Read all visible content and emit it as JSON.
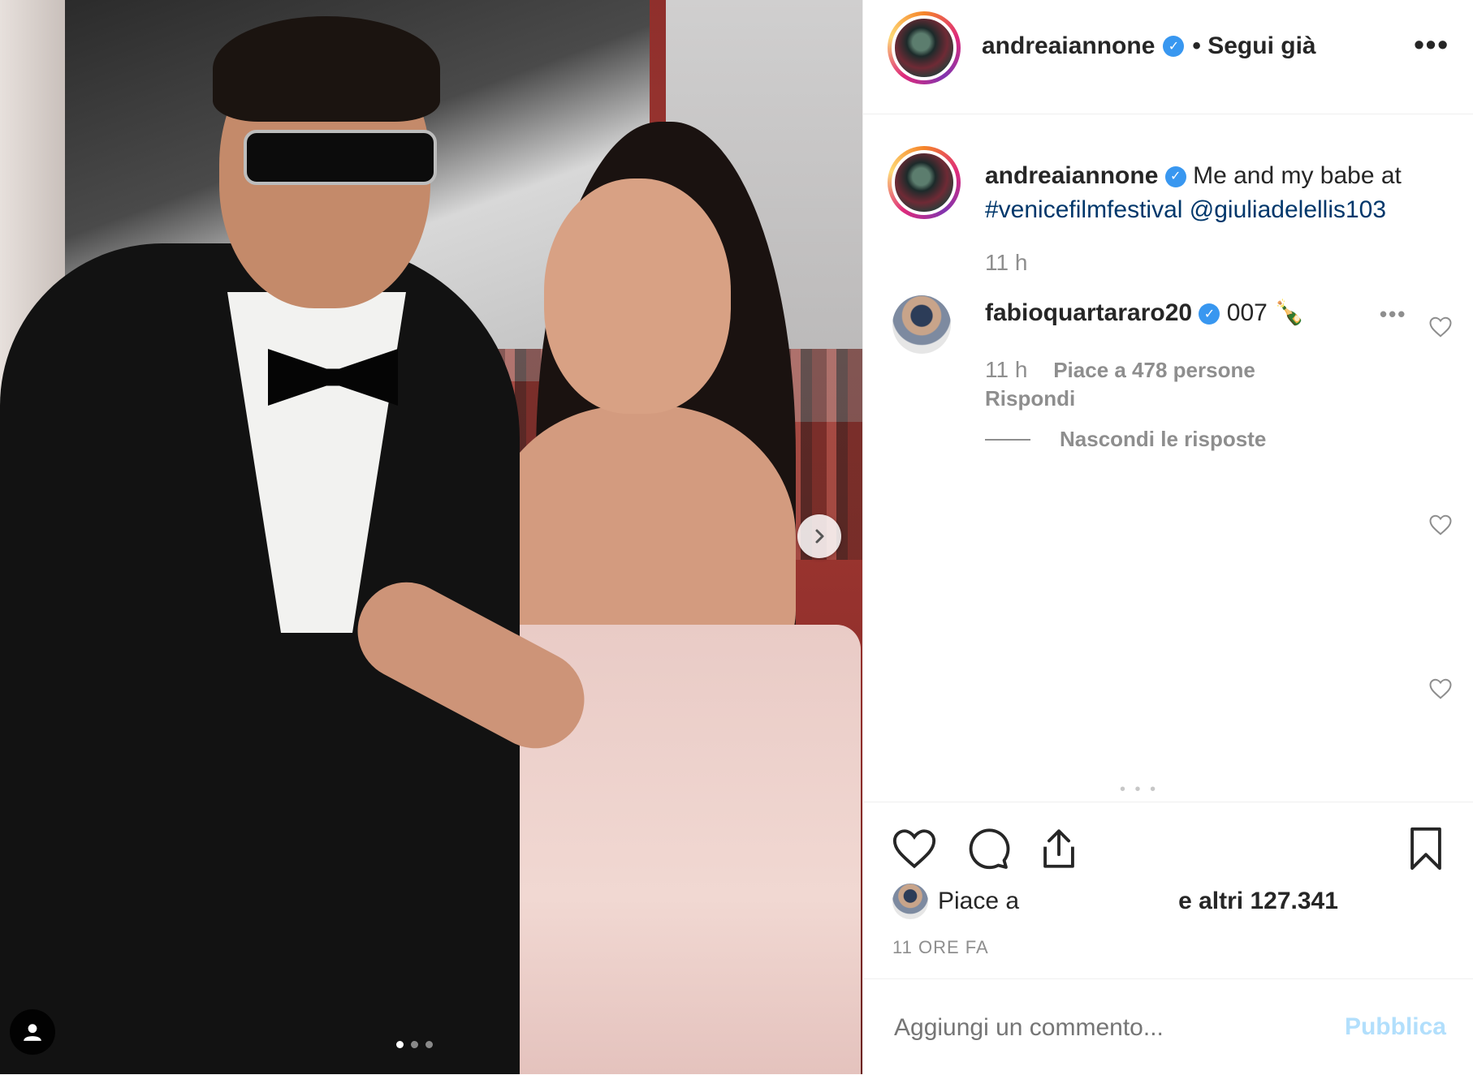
{
  "post": {
    "carousel": {
      "dots_total": 3,
      "active_dot": 0
    }
  },
  "header": {
    "username": "andreaiannone",
    "follow_status": "• Segui già",
    "more_label": "•••"
  },
  "caption": {
    "username": "andreaiannone",
    "text": "Me and my babe at",
    "hashtag": "#venicefilmfestival",
    "mention": "@giuliadelellis103",
    "time": "11 h"
  },
  "comment": {
    "username": "fabioquartararo20",
    "text": "007 🍾",
    "time": "11 h",
    "likes": "Piace a 478 persone",
    "reply": "Rispondi",
    "hide_replies": "Nascondi le risposte",
    "more_label": "•••"
  },
  "scroll_indicator": "• • •",
  "likes": {
    "prefix": "Piace a",
    "suffix": "e altri 127.341",
    "time_ago": "11 ORE FA"
  },
  "comment_box": {
    "placeholder": "Aggiungi un commento...",
    "post_label": "Pubblica"
  },
  "colors": {
    "link": "#00376b",
    "verified": "#3897f0",
    "muted": "#8e8e8e",
    "post_disabled": "#b2dffc"
  },
  "icons": [
    "chevron-right-icon",
    "user-tag-icon",
    "verified-icon",
    "heart-icon",
    "comment-icon",
    "share-icon",
    "bookmark-icon"
  ]
}
